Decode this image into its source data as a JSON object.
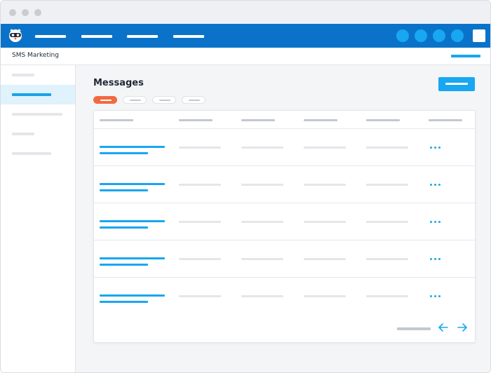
{
  "app": {
    "title": "SMS Marketing"
  },
  "page": {
    "title": "Messages"
  },
  "colors": {
    "nav_bg": "#0a73c9",
    "accent": "#18a7f0",
    "filter_active": "#f26a3f",
    "sidebar_active_bg": "#e0f2fb"
  },
  "icons": {
    "logo": "raccoon-mascot-logo",
    "more": "ellipsis-icon",
    "prev": "arrow-left-icon",
    "next": "arrow-right-icon"
  },
  "navbar": {
    "link_count": 4,
    "circle_count": 4
  },
  "sidebar": {
    "item_count": 5,
    "active_index": 1
  },
  "filters": {
    "count": 4,
    "active_index": 0
  },
  "table": {
    "column_count": 6,
    "row_count": 5
  }
}
